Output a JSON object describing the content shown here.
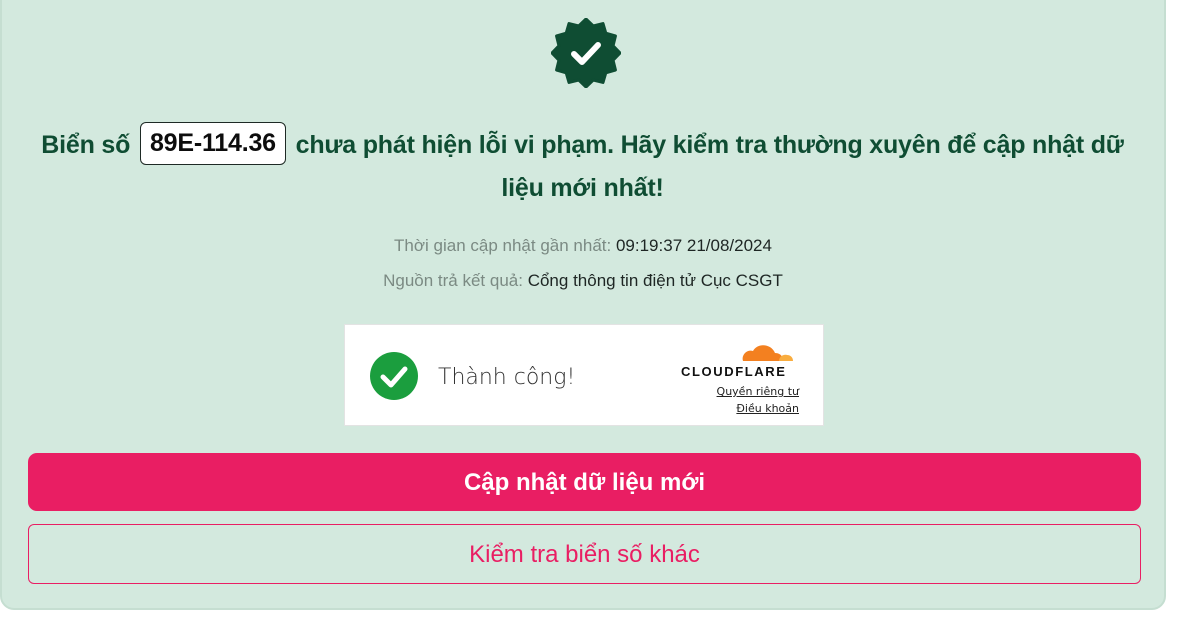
{
  "result": {
    "prefix": "Biển số",
    "plate": "89E-114.36",
    "message": "chưa phát hiện lỗi vi phạm. Hãy kiểm tra thường xuyên để cập nhật dữ liệu mới nhất!",
    "updated_label": "Thời gian cập nhật gần nhất:",
    "updated_value": "09:19:37 21/08/2024",
    "source_label": "Nguồn trả kết quả:",
    "source_value": "Cổng thông tin điện tử Cục CSGT"
  },
  "captcha": {
    "status": "Thành công!",
    "brand": "CLOUDFLARE",
    "privacy_link": "Quyền riêng tư",
    "terms_link": "Điều khoản"
  },
  "actions": {
    "refresh_label": "Cập nhật dữ liệu mới",
    "check_other_label": "Kiểm tra biển số khác"
  },
  "icons": {
    "badge": "verified-badge-icon",
    "captcha_check": "check-circle-icon",
    "cloud": "cloudflare-cloud-icon"
  },
  "colors": {
    "card_bg": "#d3e9de",
    "headline": "#0f4d33",
    "accent": "#e91e63",
    "success_green": "#1b9e3e",
    "cloudflare_orange": "#f38020"
  }
}
